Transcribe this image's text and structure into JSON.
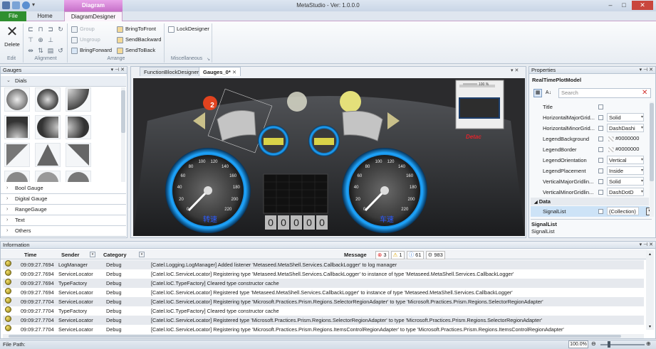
{
  "app_title": "MetaStudio - Ver: 1.0.0.0",
  "context_tab_header": "Diagram",
  "ribbon_tabs": [
    "File",
    "Home",
    "DiagramDesigner"
  ],
  "ribbon": {
    "edit": {
      "delete_label": "Delete",
      "group_label": "Edit"
    },
    "alignment": {
      "group_label": "Alignment"
    },
    "arrange": {
      "group": "Group",
      "ungroup": "Ungroup",
      "bring_forward": "BringForward",
      "bring_to_front": "BringToFront",
      "send_backward": "SendBackward",
      "send_to_back": "SendToBack",
      "group_label": "Arrange"
    },
    "misc": {
      "lock_designer": "LockDesigner",
      "group_label": "Miscellaneous"
    }
  },
  "gauges_panel": {
    "title": "Gauges",
    "dials_header": "Dials",
    "categories": [
      "Bool Gauge",
      "Digital Gauge",
      "RangeGauge",
      "Text",
      "Others"
    ]
  },
  "doc_tabs": [
    "FunctionBlockDesigner",
    "Gauges_0*"
  ],
  "dashboard": {
    "badge_number": "2",
    "left_speed_label": "转速",
    "right_speed_label": "车速",
    "odometer": [
      "0",
      "0",
      "0",
      "0",
      "0"
    ],
    "left_dial_ticks": [
      "0",
      "20",
      "40",
      "60",
      "80",
      "100",
      "120",
      "140",
      "160",
      "180",
      "200",
      "220"
    ],
    "right_dial_ticks": [
      "0",
      "20",
      "40",
      "60",
      "80",
      "100",
      "120",
      "140",
      "160",
      "180",
      "200",
      "220"
    ],
    "minimap_zoom": "100 %",
    "minimap_label": "Detac"
  },
  "properties_panel": {
    "title": "Properties",
    "object_name": "RealTimePlotModel",
    "search_placeholder": "Search",
    "rows": [
      {
        "name": "Title",
        "value": ""
      },
      {
        "name": "HorizontalMajorGrid...",
        "value": "Solid"
      },
      {
        "name": "HorizontalMinorGrid...",
        "value": "DashDashi"
      },
      {
        "name": "LegendBackground",
        "value": "#0000000"
      },
      {
        "name": "LegendBorder",
        "value": "#0000000"
      },
      {
        "name": "LegendOrientation",
        "value": "Vertical"
      },
      {
        "name": "LegendPlacement",
        "value": "Inside"
      },
      {
        "name": "VerticalMajorGridlin...",
        "value": "Solid"
      },
      {
        "name": "VerticalMinorGridlin...",
        "value": "DashDotD"
      }
    ],
    "data_category": "Data",
    "signal_row": {
      "name": "SignalList",
      "value": "(Collection)"
    },
    "desc_title": "SignalList",
    "desc_text": "SignalList"
  },
  "info_panel": {
    "title": "Information",
    "columns": {
      "time": "Time",
      "sender": "Sender",
      "category": "Category",
      "message": "Message"
    },
    "counts": {
      "errors": "3",
      "warnings": "1",
      "infos": "61",
      "total": "983"
    },
    "rows": [
      {
        "time": "09:09:27.7694",
        "sender": "LogManager",
        "category": "Debug",
        "message": "[Catel.Logging.LogManager] Added listener 'Metaseed.MetaShell.Services.CallbackLogger' to log manager"
      },
      {
        "time": "09:09:27.7694",
        "sender": "ServiceLocator",
        "category": "Debug",
        "message": "[Catel.IoC.ServiceLocator] Registering type 'Metaseed.MetaShell.Services.CallbackLogger' to instance of type 'Metaseed.MetaShell.Services.CallbackLogger'"
      },
      {
        "time": "09:09:27.7694",
        "sender": "TypeFactory",
        "category": "Debug",
        "message": "[Catel.IoC.TypeFactory] Cleared type constructor cache"
      },
      {
        "time": "09:09:27.7694",
        "sender": "ServiceLocator",
        "category": "Debug",
        "message": "[Catel.IoC.ServiceLocator] Registered type 'Metaseed.MetaShell.Services.CallbackLogger' to instance of type 'Metaseed.MetaShell.Services.CallbackLogger'"
      },
      {
        "time": "09:09:27.7704",
        "sender": "ServiceLocator",
        "category": "Debug",
        "message": "[Catel.IoC.ServiceLocator] Registering type 'Microsoft.Practices.Prism.Regions.SelectorRegionAdapter' to type 'Microsoft.Practices.Prism.Regions.SelectorRegionAdapter'"
      },
      {
        "time": "09:09:27.7704",
        "sender": "TypeFactory",
        "category": "Debug",
        "message": "[Catel.IoC.TypeFactory] Cleared type constructor cache"
      },
      {
        "time": "09:09:27.7704",
        "sender": "ServiceLocator",
        "category": "Debug",
        "message": "[Catel.IoC.ServiceLocator] Registered type 'Microsoft.Practices.Prism.Regions.SelectorRegionAdapter' to type 'Microsoft.Practices.Prism.Regions.SelectorRegionAdapter'"
      },
      {
        "time": "09:09:27.7704",
        "sender": "ServiceLocator",
        "category": "Debug",
        "message": "[Catel.IoC.ServiceLocator] Registering type 'Microsoft.Practices.Prism.Regions.ItemsControlRegionAdapter' to type 'Microsoft.Practices.Prism.Regions.ItemsControlRegionAdapter'"
      }
    ]
  },
  "status": {
    "file_path_label": "File Path:",
    "zoom": "100.0%"
  },
  "colors": {
    "accent_context": "#c770c9",
    "file_tab": "#2f8f2f",
    "canvas_bg": "#2e2e30",
    "dial_glow": "#1ea6ff"
  }
}
